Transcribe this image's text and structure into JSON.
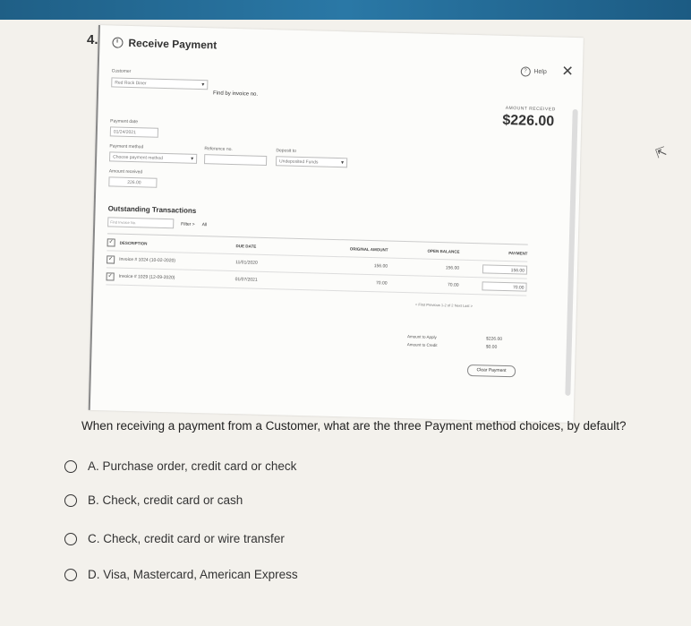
{
  "question_number": "4.",
  "dialog": {
    "title": "Receive Payment",
    "help": "Help",
    "customer_label": "Customer",
    "customer_value": "Red Rock Diner",
    "find_by_invoice": "Find by invoice no.",
    "payment_date_label": "Payment date",
    "payment_date_value": "01/24/2021",
    "payment_method_label": "Payment method",
    "payment_method_placeholder": "Choose payment method",
    "reference_label": "Reference no.",
    "deposit_to_label": "Deposit to",
    "deposit_to_value": "Undeposited Funds",
    "amount_received_label": "Amount received",
    "amount_received_value": "226.00",
    "amount_received_big_label": "AMOUNT RECEIVED",
    "amount_received_big": "$226.00",
    "outstanding_title": "Outstanding Transactions",
    "find_invoice_placeholder": "Find Invoice No.",
    "filter_button": "Filter >",
    "filter_all": "All",
    "table": {
      "headers": [
        "DESCRIPTION",
        "DUE DATE",
        "ORIGINAL AMOUNT",
        "OPEN BALANCE",
        "PAYMENT"
      ],
      "rows": [
        {
          "description": "Invoice # 1024 (10-02-2020)",
          "due_date": "11/01/2020",
          "original": "156.00",
          "open": "156.00",
          "payment": "156.00"
        },
        {
          "description": "Invoice # 1029 (12-09-2020)",
          "due_date": "01/07/2021",
          "original": "70.00",
          "open": "70.00",
          "payment": "70.00"
        }
      ]
    },
    "pager": "< First  Previous  1-2 of 2  Next  Last >",
    "amount_to_apply_label": "Amount to Apply",
    "amount_to_apply_value": "$226.00",
    "amount_to_credit_label": "Amount to Credit",
    "amount_to_credit_value": "$0.00",
    "clear_payment": "Clear Payment"
  },
  "question": "When receiving a payment from a Customer, what are the three Payment method choices, by default?",
  "choices": [
    "A.  Purchase order, credit card or check",
    "B.  Check, credit card or cash",
    "C.  Check, credit card or wire transfer",
    "D.  Visa, Mastercard, American Express"
  ]
}
